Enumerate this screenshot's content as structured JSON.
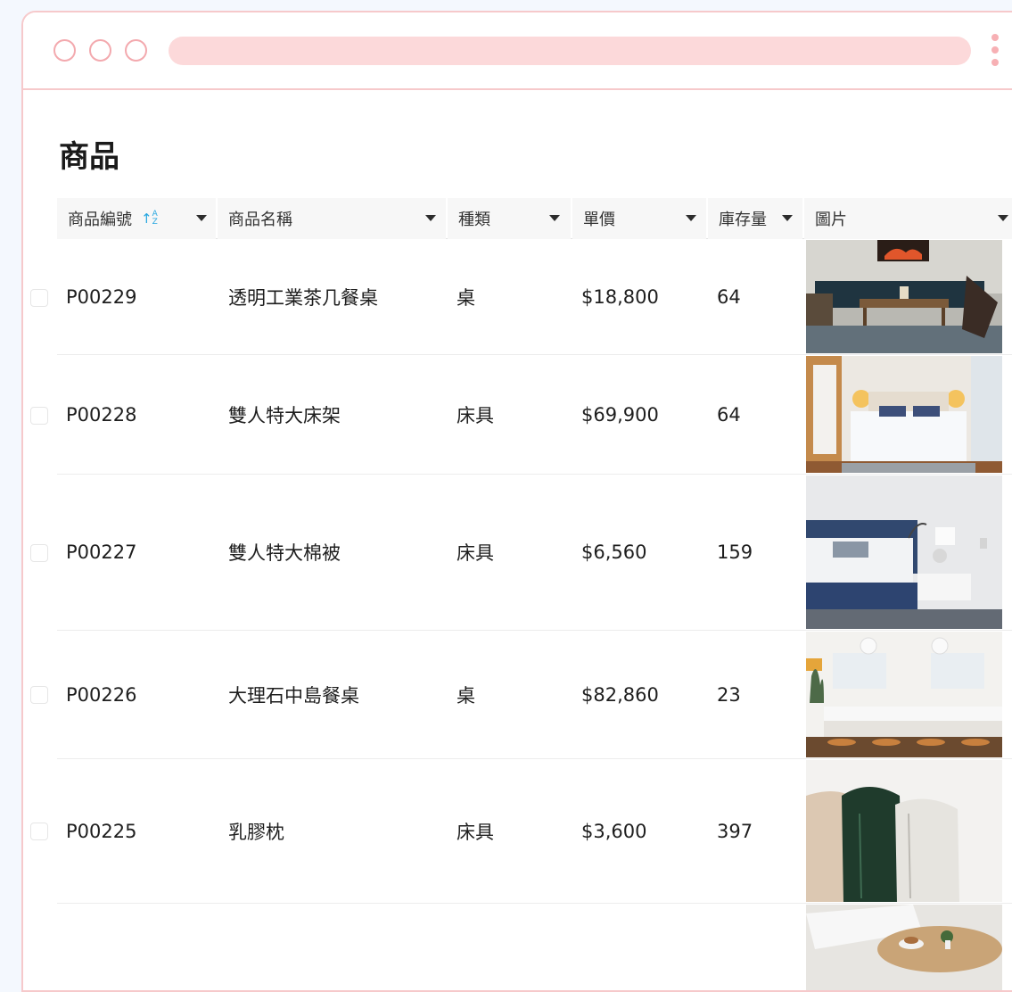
{
  "page": {
    "title": "商品"
  },
  "columns": {
    "id": "商品編號",
    "name": "商品名稱",
    "category": "種類",
    "price": "單價",
    "stock": "庫存量",
    "image": "圖片"
  },
  "sort": {
    "column": "商品編號",
    "icon": "sort-a-z-icon",
    "top_letter": "A",
    "bottom_letter": "Z"
  },
  "rows": [
    {
      "id": "P00229",
      "name": "透明工業茶几餐桌",
      "category": "桌",
      "price": "$18,800",
      "stock": "64",
      "image": "living-room-photo"
    },
    {
      "id": "P00228",
      "name": "雙人特大床架",
      "category": "床具",
      "price": "$69,900",
      "stock": "64",
      "image": "bedroom-photo"
    },
    {
      "id": "P00227",
      "name": "雙人特大棉被",
      "category": "床具",
      "price": "$6,560",
      "stock": "159",
      "image": "navy-bedroom-photo"
    },
    {
      "id": "P00226",
      "name": "大理石中島餐桌",
      "category": "桌",
      "price": "$82,860",
      "stock": "23",
      "image": "kitchen-photo"
    },
    {
      "id": "P00225",
      "name": "乳膠枕",
      "category": "床具",
      "price": "$3,600",
      "stock": "397",
      "image": "pillows-photo"
    },
    {
      "id": "",
      "name": "",
      "category": "",
      "price": "",
      "stock": "",
      "image": "coffee-table-photo"
    }
  ],
  "colors": {
    "accent_border": "#f6c9cb",
    "urlbar": "#fcd9da",
    "sort_icon": "#27a7e0"
  }
}
